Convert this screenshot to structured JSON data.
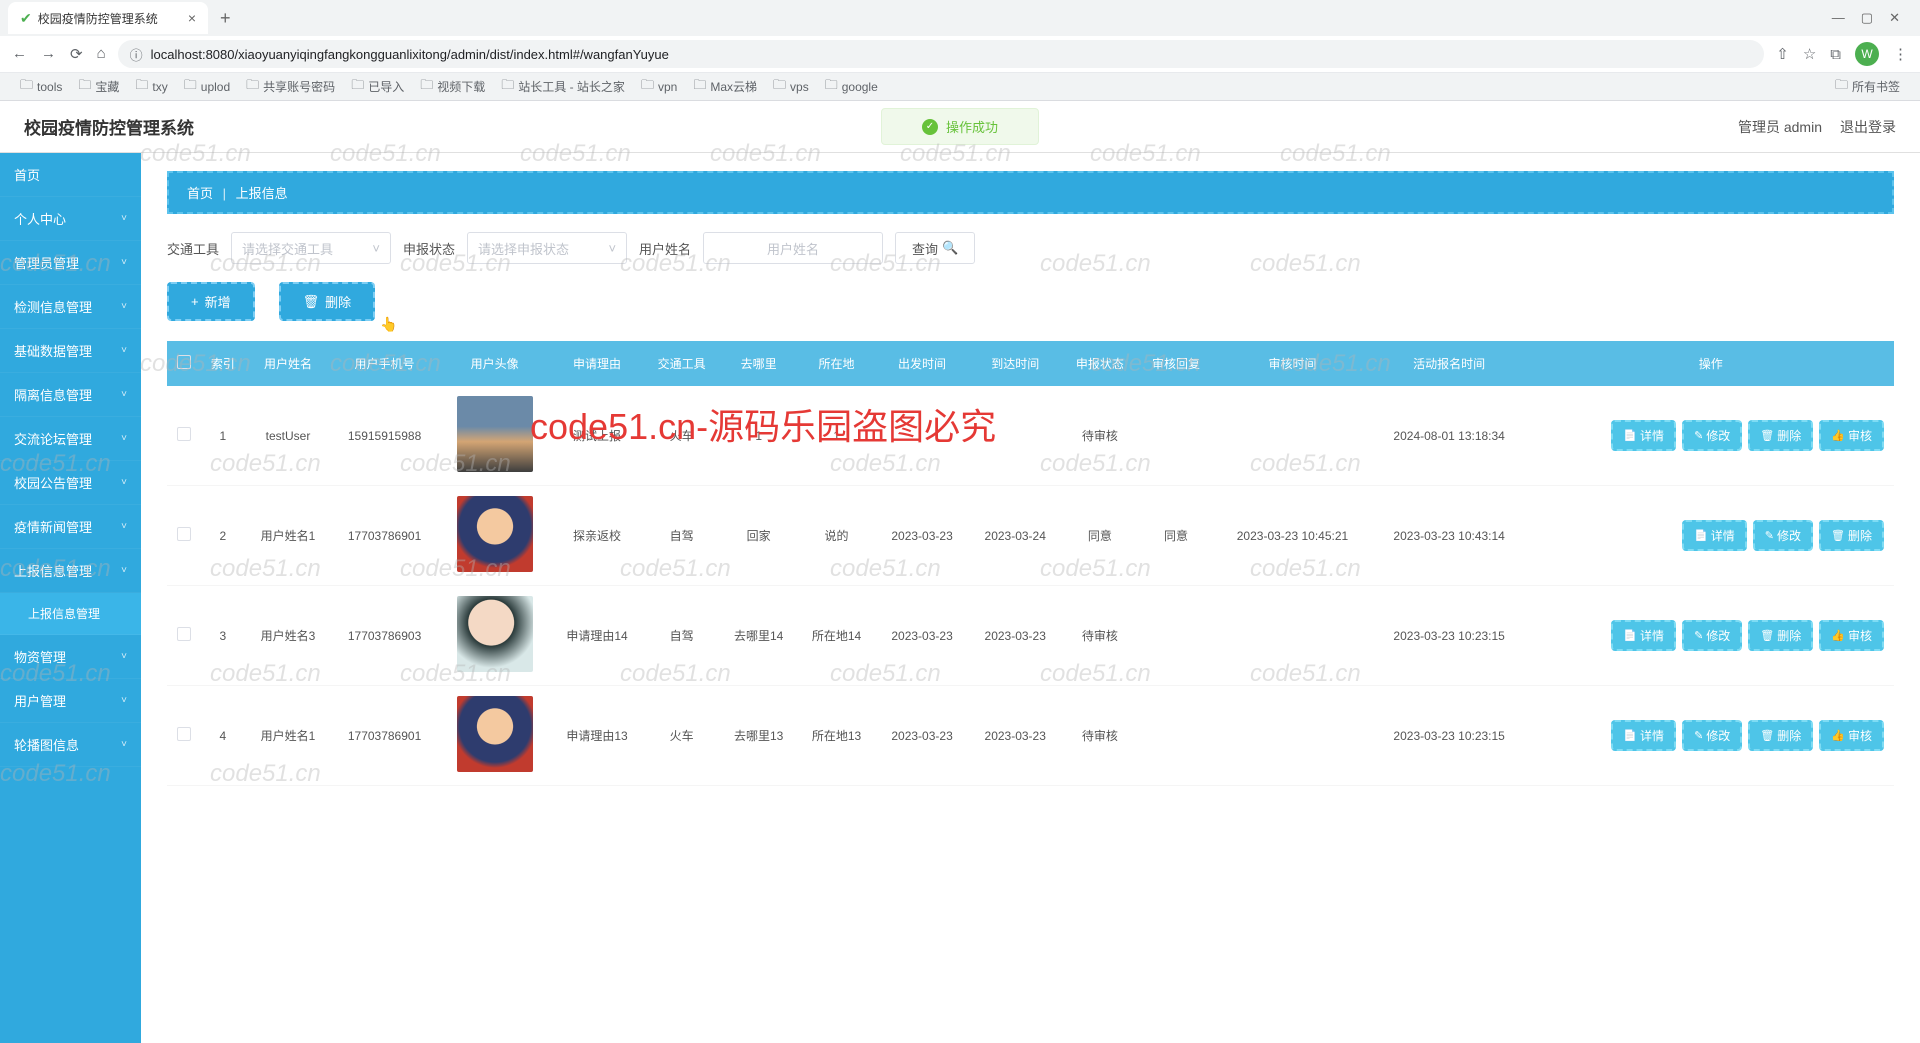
{
  "browser": {
    "tab_title": "校园疫情防控管理系统",
    "url": "localhost:8080/xiaoyuanyiqingfangkongguanlixitong/admin/dist/index.html#/wangfanYuyue",
    "bookmarks": [
      "tools",
      "宝藏",
      "txy",
      "uplod",
      "共享账号密码",
      "已导入",
      "视频下载",
      "站长工具 - 站长之家",
      "vpn",
      "Max云梯",
      "vps",
      "google"
    ],
    "all_bookmarks": "所有书签",
    "avatar_letter": "W"
  },
  "header": {
    "title": "校园疫情防控管理系统",
    "toast": "操作成功",
    "admin_label": "管理员 admin",
    "logout": "退出登录"
  },
  "sidebar": {
    "items": [
      {
        "label": "首页",
        "expand": false
      },
      {
        "label": "个人中心",
        "expand": true
      },
      {
        "label": "管理员管理",
        "expand": true
      },
      {
        "label": "检测信息管理",
        "expand": true
      },
      {
        "label": "基础数据管理",
        "expand": true
      },
      {
        "label": "隔离信息管理",
        "expand": true
      },
      {
        "label": "交流论坛管理",
        "expand": true
      },
      {
        "label": "校园公告管理",
        "expand": true
      },
      {
        "label": "疫情新闻管理",
        "expand": true
      },
      {
        "label": "上报信息管理",
        "expand": true
      },
      {
        "label": "物资管理",
        "expand": true
      },
      {
        "label": "用户管理",
        "expand": true
      },
      {
        "label": "轮播图信息",
        "expand": true
      }
    ],
    "sub_active": "上报信息管理"
  },
  "breadcrumb": {
    "home": "首页",
    "current": "上报信息"
  },
  "filters": {
    "transport_label": "交通工具",
    "transport_placeholder": "请选择交通工具",
    "status_label": "申报状态",
    "status_placeholder": "请选择申报状态",
    "username_label": "用户姓名",
    "username_placeholder": "用户姓名",
    "query": "查询"
  },
  "actions": {
    "add": "新增",
    "delete": "删除"
  },
  "table": {
    "headers": [
      "索引",
      "用户姓名",
      "用户手机号",
      "用户头像",
      "申请理由",
      "交通工具",
      "去哪里",
      "所在地",
      "出发时间",
      "到达时间",
      "申报状态",
      "审核回复",
      "审核时间",
      "活动报名时间",
      "操作"
    ],
    "rows": [
      {
        "idx": "1",
        "name": "testUser",
        "phone": "15915915988",
        "reason": "测试上报",
        "transport": "火车",
        "dest": "1",
        "loc": "1",
        "depart": "",
        "arrive": "",
        "status": "待审核",
        "reply": "",
        "review_time": "",
        "apply_time": "2024-08-01 13:18:34",
        "audit": true
      },
      {
        "idx": "2",
        "name": "用户姓名1",
        "phone": "17703786901",
        "reason": "探亲返校",
        "transport": "自驾",
        "dest": "回家",
        "loc": "说的",
        "depart": "2023-03-23",
        "arrive": "2023-03-24",
        "status": "同意",
        "reply": "同意",
        "review_time": "2023-03-23 10:45:21",
        "apply_time": "2023-03-23 10:43:14",
        "audit": false
      },
      {
        "idx": "3",
        "name": "用户姓名3",
        "phone": "17703786903",
        "reason": "申请理由14",
        "transport": "自驾",
        "dest": "去哪里14",
        "loc": "所在地14",
        "depart": "2023-03-23",
        "arrive": "2023-03-23",
        "status": "待审核",
        "reply": "",
        "review_time": "",
        "apply_time": "2023-03-23 10:23:15",
        "audit": true
      },
      {
        "idx": "4",
        "name": "用户姓名1",
        "phone": "17703786901",
        "reason": "申请理由13",
        "transport": "火车",
        "dest": "去哪里13",
        "loc": "所在地13",
        "depart": "2023-03-23",
        "arrive": "2023-03-23",
        "status": "待审核",
        "reply": "",
        "review_time": "",
        "apply_time": "2023-03-23 10:23:15",
        "audit": true
      }
    ],
    "btn_detail": "详情",
    "btn_edit": "修改",
    "btn_delete": "删除",
    "btn_audit": "审核"
  },
  "watermark_text": "code51.cn",
  "overlay_text": "code51.cn-源码乐园盗图必究"
}
